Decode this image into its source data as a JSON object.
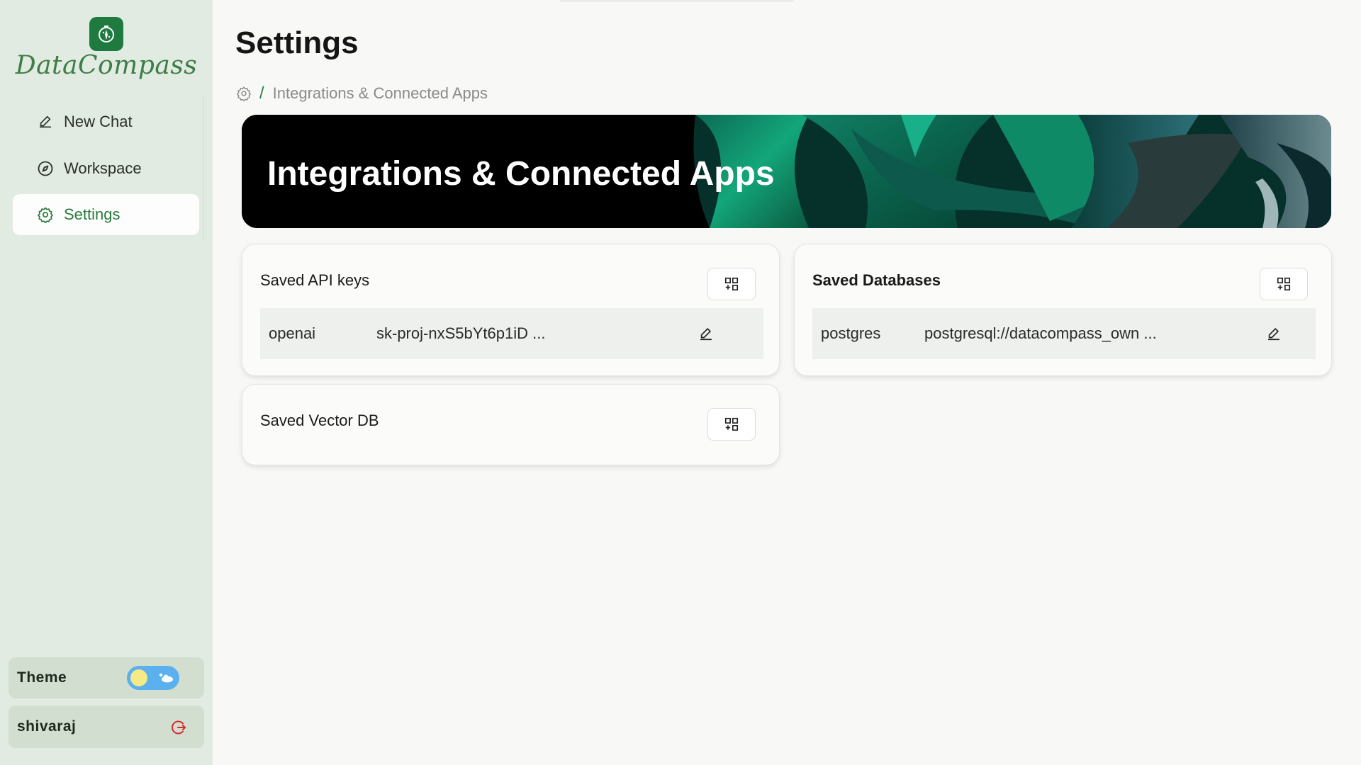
{
  "app": {
    "name": "DataCompass"
  },
  "sidebar": {
    "items": [
      {
        "label": "New Chat",
        "icon": "pencil-icon"
      },
      {
        "label": "Workspace",
        "icon": "compass-icon"
      },
      {
        "label": "Settings",
        "icon": "gear-icon",
        "active": true
      }
    ],
    "theme_label": "Theme",
    "theme_mode": "light",
    "user_name": "shivaraj"
  },
  "page": {
    "title": "Settings",
    "breadcrumb": {
      "separator": "/",
      "current": "Integrations & Connected Apps"
    },
    "banner_title": "Integrations & Connected Apps"
  },
  "cards": {
    "api_keys": {
      "title": "Saved API keys",
      "items": [
        {
          "name": "openai",
          "value": "sk-proj-nxS5bYt6p1iD ..."
        }
      ]
    },
    "databases": {
      "title": "Saved Databases",
      "items": [
        {
          "name": "postgres",
          "value": "postgresql://datacompass_own ..."
        }
      ]
    },
    "vector_db": {
      "title": "Saved Vector DB",
      "items": []
    }
  },
  "colors": {
    "accent": "#2a7a3f",
    "sidebar_bg": "#e2ebe1",
    "logout": "#d92b2b",
    "toggle_bg": "#5bb0ee"
  }
}
